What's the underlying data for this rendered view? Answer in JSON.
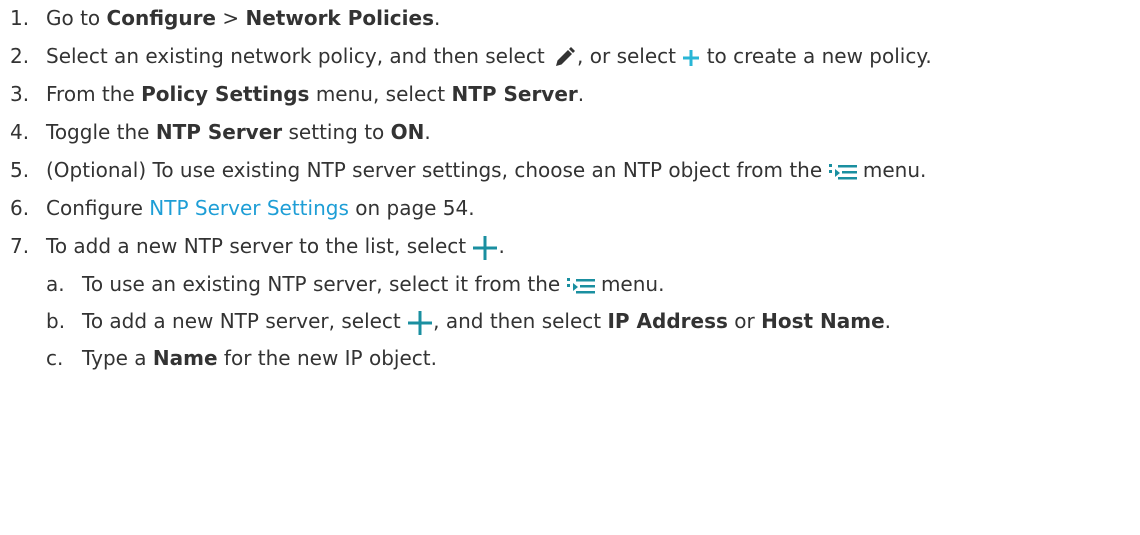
{
  "colors": {
    "text": "#333333",
    "link": "#1e9ed6",
    "icon_teal": "#1a8fa0",
    "icon_plus_light": "#29b6d6",
    "pencil": "#333333"
  },
  "steps": [
    {
      "num": "1.",
      "parts": [
        "Go to ",
        "Configure",
        " > ",
        "Network Policies",
        "."
      ]
    },
    {
      "num": "2.",
      "parts": [
        "Select an existing network policy, and then select ",
        ", or select ",
        " to create a new policy."
      ],
      "icons": [
        "pencil-icon",
        "plus-icon"
      ]
    },
    {
      "num": "3.",
      "parts": [
        "From the ",
        "Policy Settings",
        " menu, select ",
        "NTP Server",
        "."
      ]
    },
    {
      "num": "4.",
      "parts": [
        "Toggle the ",
        "NTP Server",
        " setting to ",
        "ON",
        "."
      ]
    },
    {
      "num": "5.",
      "parts": [
        "(Optional) To use existing NTP server settings, choose an NTP object from the ",
        " menu."
      ],
      "icons": [
        "select-list-icon"
      ]
    },
    {
      "num": "6.",
      "parts": [
        "Configure ",
        "NTP Server Settings",
        " on page 54."
      ]
    },
    {
      "num": "7.",
      "parts": [
        "To add a new NTP server to the list, select ",
        "."
      ],
      "icons": [
        "plus-icon"
      ]
    }
  ],
  "substeps": [
    {
      "num": "a.",
      "parts": [
        "To use an existing NTP server, select it from the ",
        " menu."
      ],
      "icons": [
        "select-list-icon"
      ]
    },
    {
      "num": "b.",
      "parts": [
        "To add a new NTP server, select ",
        ", and then select ",
        "IP Address",
        " or ",
        "Host Name",
        "."
      ],
      "icons": [
        "plus-icon"
      ]
    },
    {
      "num": "c.",
      "parts": [
        "Type a ",
        "Name",
        " for the new IP object."
      ]
    }
  ]
}
